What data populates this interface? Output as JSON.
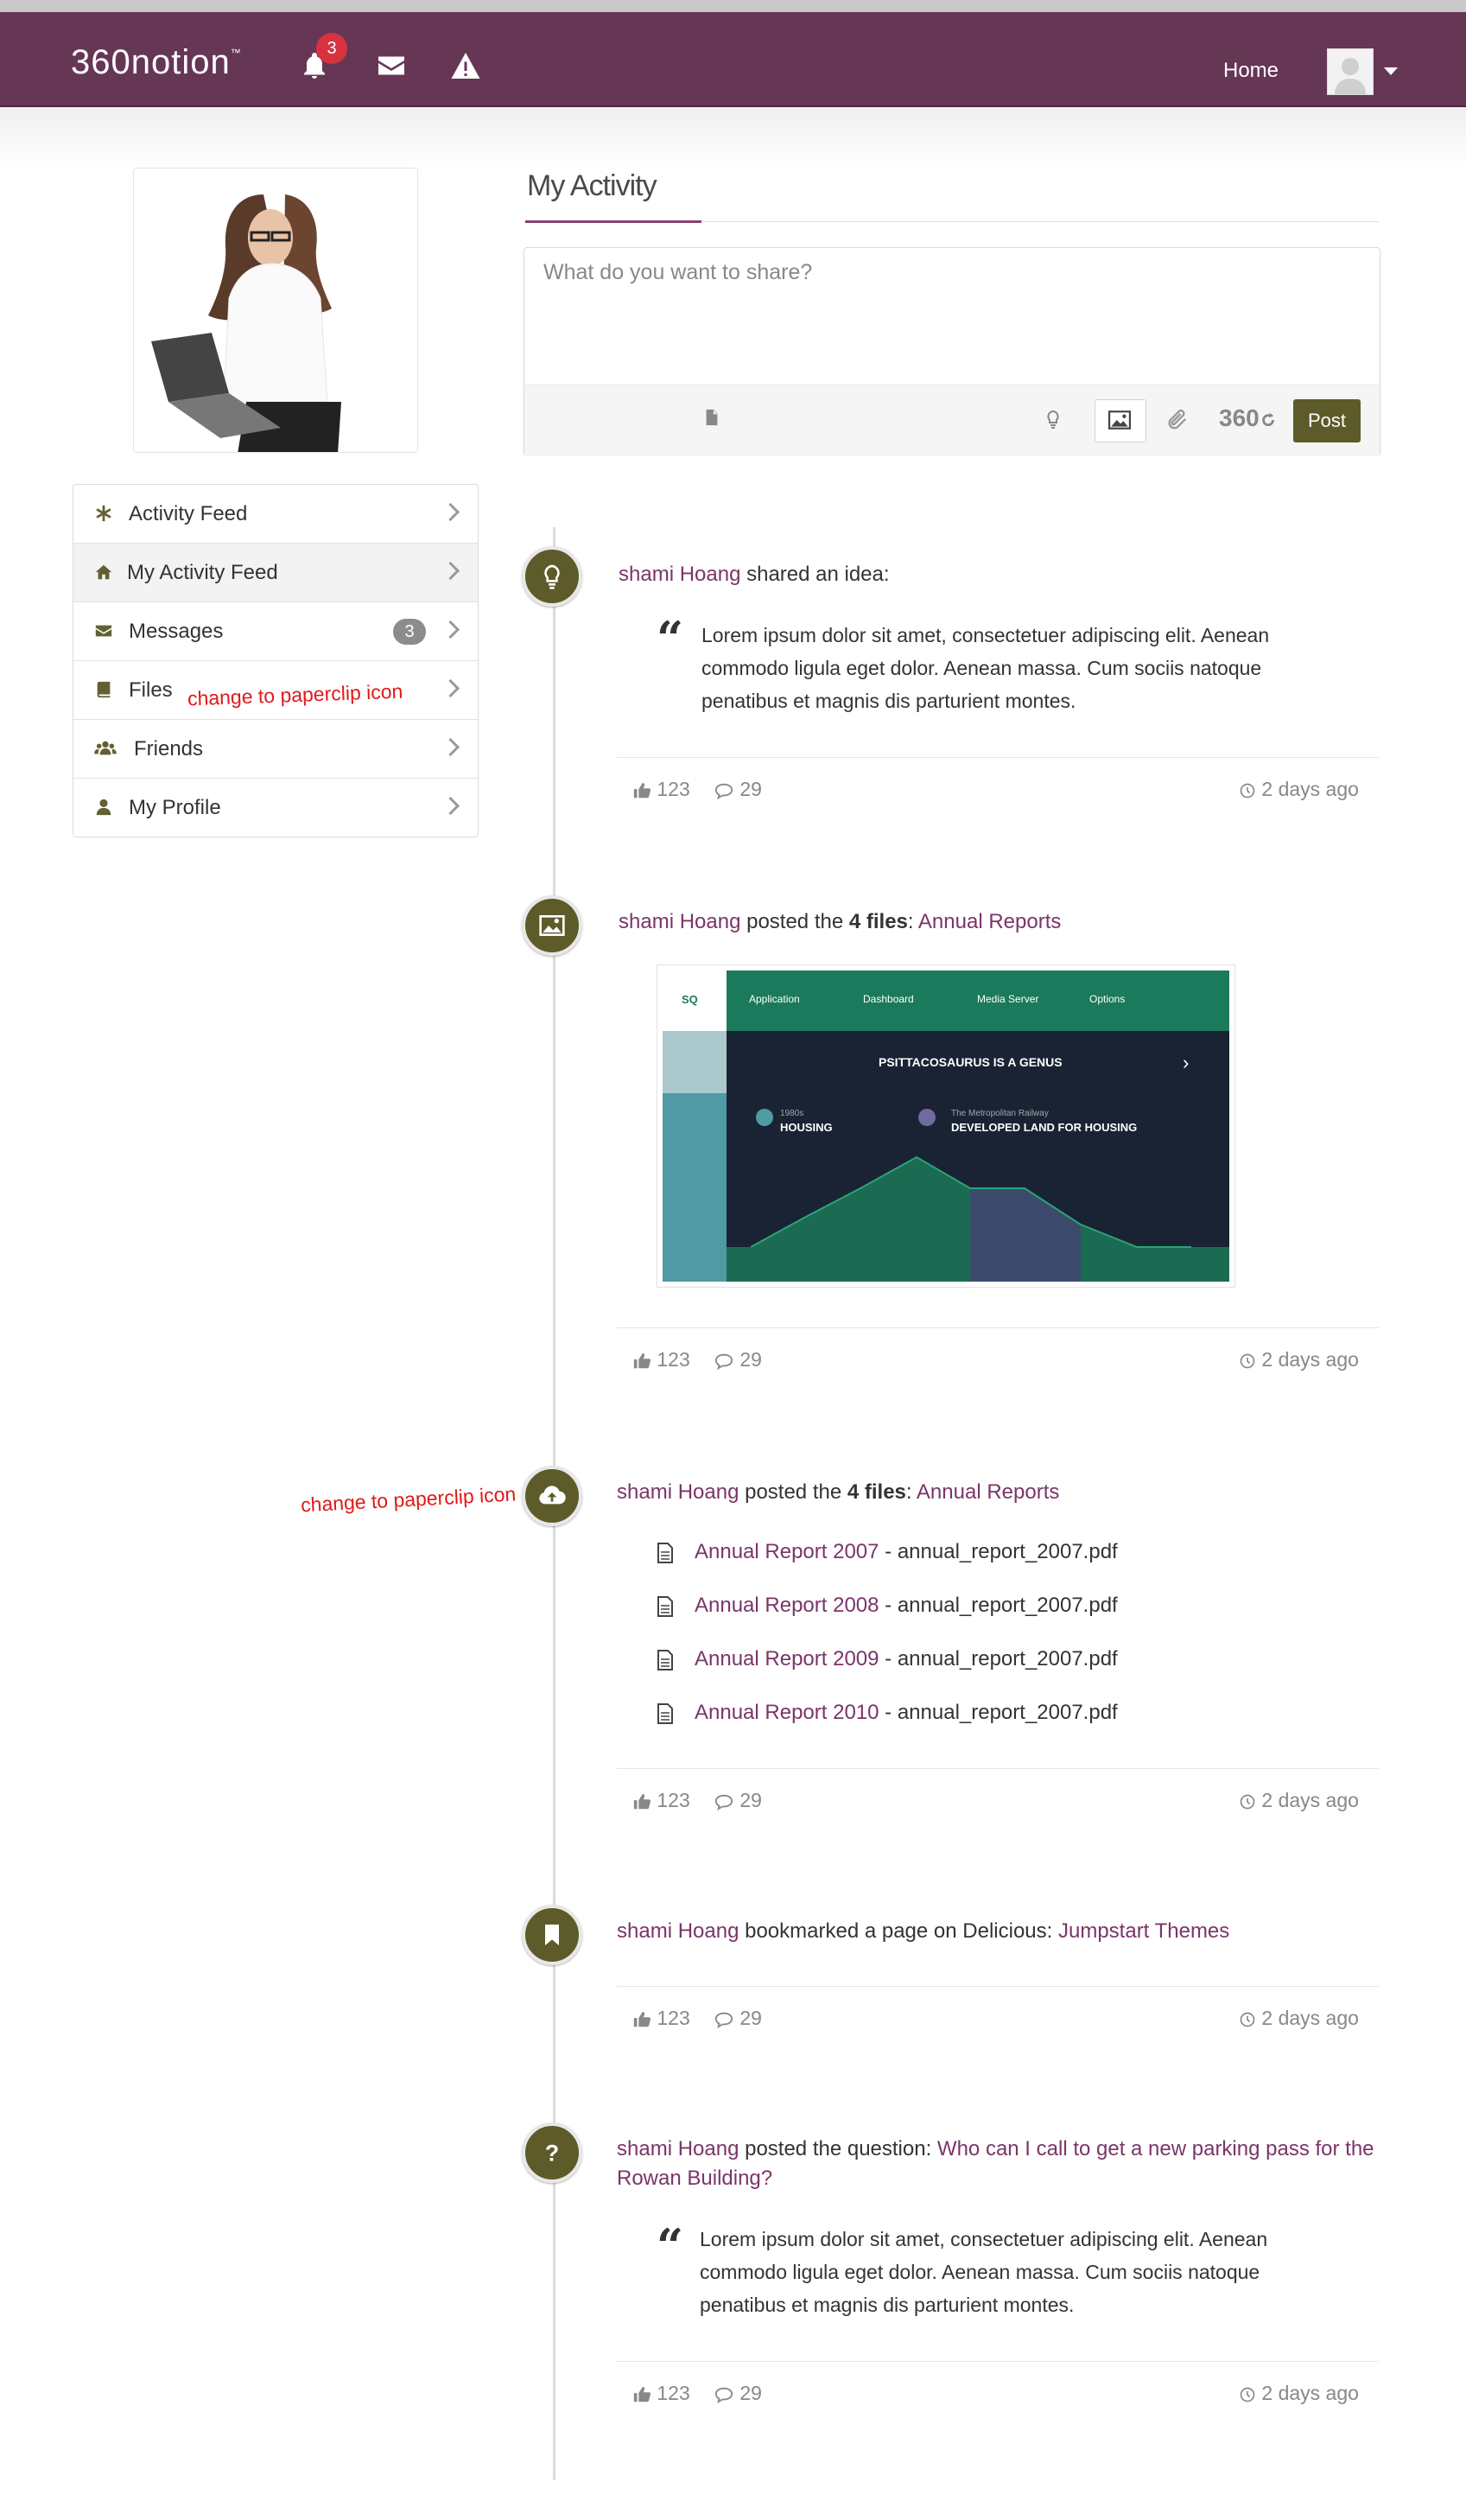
{
  "app": {
    "brand": "360notion",
    "brand_mark": "™",
    "notifications_count": "3",
    "nav_home": "Home"
  },
  "colors": {
    "navbar": "#663655",
    "accent": "#5e5b2a",
    "link": "#7a3568",
    "annotation": "#e11919"
  },
  "sidebar": {
    "items": [
      {
        "label": "Activity Feed",
        "icon": "asterisk-icon"
      },
      {
        "label": "My Activity Feed",
        "icon": "home-icon"
      },
      {
        "label": "Messages",
        "icon": "envelope-icon",
        "badge": "3"
      },
      {
        "label": "Files",
        "icon": "book-icon"
      },
      {
        "label": "Friends",
        "icon": "users-icon"
      },
      {
        "label": "My Profile",
        "icon": "user-icon"
      }
    ],
    "files_annotation": "change to paperclip icon"
  },
  "main": {
    "title": "My Activity",
    "composer_placeholder": "What do you want to share?",
    "composer_360": "360",
    "post_label": "Post"
  },
  "timeline": {
    "annotation": "change to paperclip icon",
    "entries": [
      {
        "icon": "lightbulb-icon",
        "user": "shami Hoang",
        "action": " shared an idea:",
        "quote": "Lorem ipsum dolor sit amet, consectetuer adipiscing elit. Aenean commodo ligula eget dolor. Aenean massa. Cum sociis natoque penatibus et magnis dis parturient montes.",
        "likes": "123",
        "comments": "29",
        "time": "2 days ago"
      },
      {
        "icon": "image-icon",
        "user": "shami Hoang",
        "action": " posted the ",
        "count": "4 files",
        "colon": ": ",
        "link": "Annual Reports",
        "likes": "123",
        "comments": "29",
        "time": "2 days ago",
        "preview": {
          "logo": "SQ",
          "tabs": [
            "Application",
            "Dashboard",
            "Media Server",
            "Options"
          ],
          "heading": "PSITTACOSAURUS IS A GENUS",
          "legend1_sub": "1980s",
          "legend1": "HOUSING",
          "legend2_sub": "The Metropolitan Railway",
          "legend2": "DEVELOPED LAND FOR HOUSING"
        }
      },
      {
        "icon": "cloud-upload-icon",
        "user": "shami Hoang",
        "action": " posted the ",
        "count": "4 files",
        "colon": ": ",
        "link": "Annual Reports",
        "files": [
          {
            "name": "Annual Report 2007",
            "file": " - annual_report_2007.pdf"
          },
          {
            "name": "Annual Report 2008",
            "file": " - annual_report_2007.pdf"
          },
          {
            "name": "Annual Report 2009",
            "file": " - annual_report_2007.pdf"
          },
          {
            "name": "Annual Report 2010",
            "file": " - annual_report_2007.pdf"
          }
        ],
        "likes": "123",
        "comments": "29",
        "time": "2 days ago"
      },
      {
        "icon": "bookmark-icon",
        "user": "shami Hoang",
        "action": " bookmarked a page on Delicious: ",
        "link": "Jumpstart Themes",
        "likes": "123",
        "comments": "29",
        "time": "2 days ago"
      },
      {
        "icon": "question-icon",
        "user": "shami Hoang",
        "action": " posted the question: ",
        "link": "Who can I call to get a new parking pass for the Rowan Building?",
        "quote": "Lorem ipsum dolor sit amet, consectetuer adipiscing elit. Aenean commodo ligula eget dolor. Aenean massa. Cum sociis natoque penatibus et magnis dis parturient montes.",
        "likes": "123",
        "comments": "29",
        "time": "2 days ago"
      }
    ]
  }
}
